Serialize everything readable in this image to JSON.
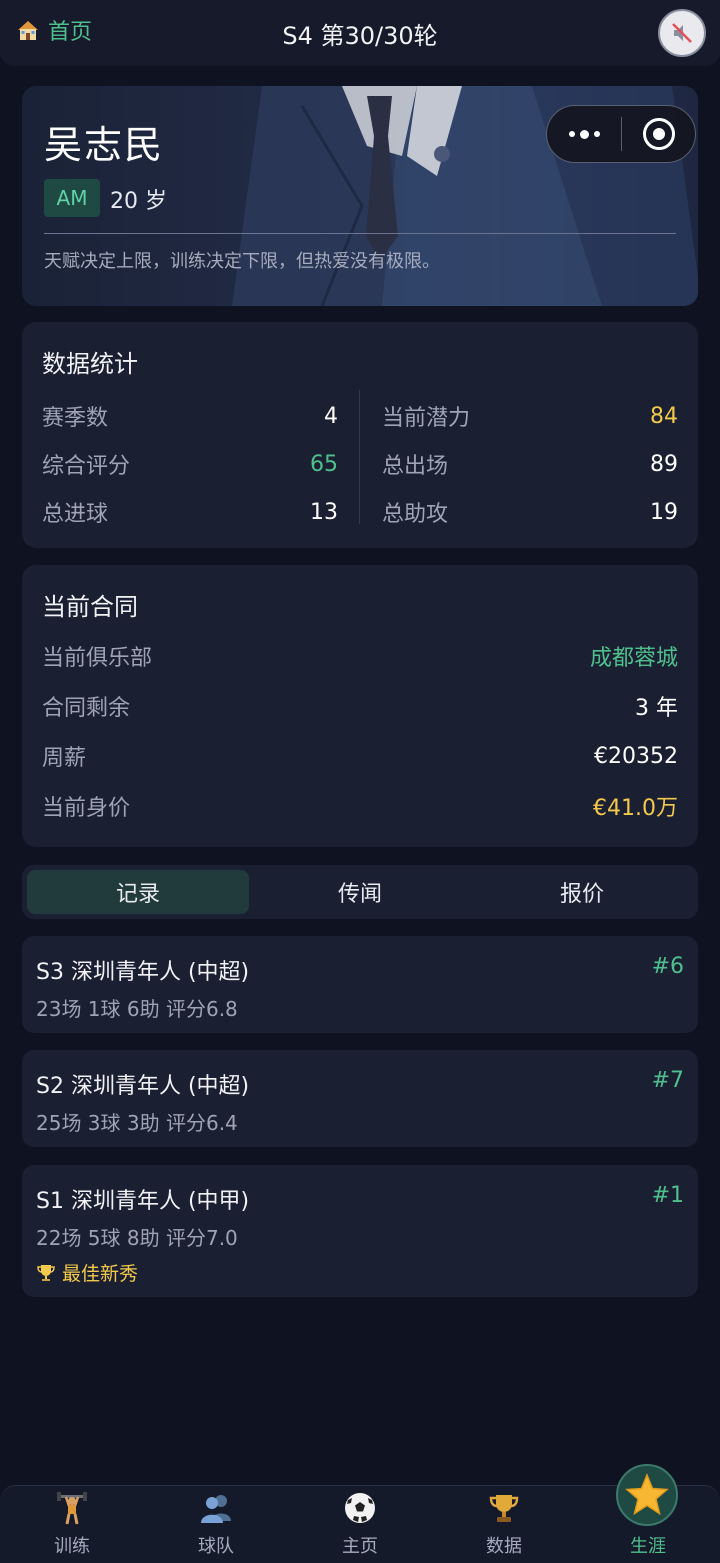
{
  "header": {
    "home_label": "首页",
    "round_title": "S4 第30/30轮"
  },
  "player": {
    "name": "吴志民",
    "position": "AM",
    "age": "20 岁",
    "motto": "天赋决定上限，训练决定下限，但热爱没有极限。"
  },
  "stats": {
    "title": "数据统计",
    "left": [
      {
        "label": "赛季数",
        "value": "4"
      },
      {
        "label": "综合评分",
        "value": "65"
      },
      {
        "label": "总进球",
        "value": "13"
      }
    ],
    "right": [
      {
        "label": "当前潜力",
        "value": "84"
      },
      {
        "label": "总出场",
        "value": "89"
      },
      {
        "label": "总助攻",
        "value": "19"
      }
    ]
  },
  "contract": {
    "title": "当前合同",
    "rows": [
      {
        "label": "当前俱乐部",
        "value": "成都蓉城"
      },
      {
        "label": "合同剩余",
        "value": "3 年"
      },
      {
        "label": "周薪",
        "value": "€20352"
      },
      {
        "label": "当前身价",
        "value": "€41.0万"
      }
    ]
  },
  "tabs": [
    "记录",
    "传闻",
    "报价"
  ],
  "records": [
    {
      "title": "S3  深圳青年人 (中超)",
      "rank": "#6",
      "stats": "23场  1球  6助  评分6.8"
    },
    {
      "title": "S2  深圳青年人 (中超)",
      "rank": "#7",
      "stats": "25场  3球  3助  评分6.4"
    },
    {
      "title": "S1  深圳青年人 (中甲)",
      "rank": "#1",
      "stats": "22场  5球  8助  评分7.0",
      "award": "最佳新秀"
    }
  ],
  "nav": [
    {
      "label": "训练",
      "icon": "weightlifter-icon"
    },
    {
      "label": "球队",
      "icon": "team-icon"
    },
    {
      "label": "主页",
      "icon": "soccer-ball-icon"
    },
    {
      "label": "数据",
      "icon": "trophy-icon"
    },
    {
      "label": "生涯",
      "icon": "star-icon"
    }
  ],
  "colors": {
    "background": "#0f1220",
    "card": "#1a1f31",
    "accent_green": "#4fc08d",
    "accent_gold": "#f2c94c"
  }
}
